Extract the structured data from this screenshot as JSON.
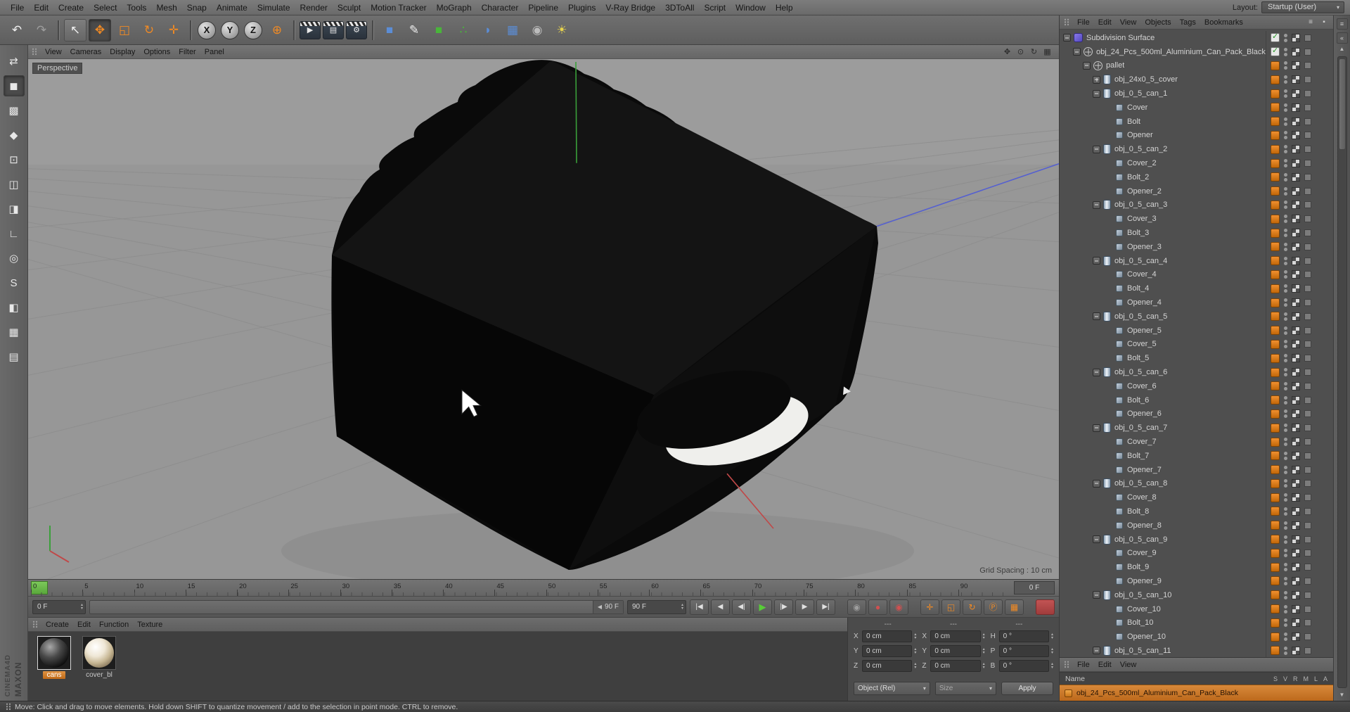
{
  "colors": {
    "accent_orange": "#F08A24",
    "axis_x_red": "#C04848",
    "axis_y_green": "#3AA03A",
    "axis_z_blue": "#5560D0",
    "current_frame_green": "#6FC04A",
    "material_tag_orange": "#D9801E",
    "selected_row_orange": "#C8772B"
  },
  "menu_bar": {
    "items": [
      "File",
      "Edit",
      "Create",
      "Select",
      "Tools",
      "Mesh",
      "Snap",
      "Animate",
      "Simulate",
      "Render",
      "Sculpt",
      "Motion Tracker",
      "MoGraph",
      "Character",
      "Pipeline",
      "Plugins",
      "V-Ray Bridge",
      "3DToAll",
      "Script",
      "Window",
      "Help"
    ],
    "layout_label": "Layout:",
    "layout_value": "Startup (User)"
  },
  "toolbar": {
    "buttons": [
      {
        "name": "undo-button",
        "g": "↶",
        "c": "c-white"
      },
      {
        "name": "redo-button",
        "g": "↷",
        "c": "c-dim"
      },
      {
        "name": "toolbar-separator",
        "g": "",
        "c": "sep",
        "ia": "false"
      },
      {
        "name": "live-selection-button",
        "g": "↖",
        "c": "c-white",
        "s": "raised"
      },
      {
        "name": "move-tool-button",
        "g": "✥",
        "c": "c-orange",
        "s": "pressed"
      },
      {
        "name": "scale-tool-button",
        "g": "◱",
        "c": "c-orange"
      },
      {
        "name": "rotate-tool-button",
        "g": "↻",
        "c": "c-orange"
      },
      {
        "name": "last-tool-button",
        "g": "✛",
        "c": "c-orange"
      },
      {
        "name": "toolbar-separator",
        "g": "",
        "c": "sep",
        "ia": "false"
      },
      {
        "name": "x-axis-lock-button",
        "g": "X",
        "c": "axis"
      },
      {
        "name": "y-axis-lock-button",
        "g": "Y",
        "c": "axis"
      },
      {
        "name": "z-axis-lock-button",
        "g": "Z",
        "c": "axis"
      },
      {
        "name": "coordinate-system-button",
        "g": "⊕",
        "c": "c-orange"
      },
      {
        "name": "toolbar-separator",
        "g": "",
        "c": "sep",
        "ia": "false"
      },
      {
        "name": "render-view-button",
        "g": "▶",
        "c": "clapper"
      },
      {
        "name": "render-picture-viewer-button",
        "g": "▤",
        "c": "clapper"
      },
      {
        "name": "render-settings-button",
        "g": "⚙",
        "c": "clapper"
      },
      {
        "name": "toolbar-separator",
        "g": "",
        "c": "sep",
        "ia": "false"
      },
      {
        "name": "primitive-cube-button",
        "g": "■",
        "c": "c-blue"
      },
      {
        "name": "spline-pen-button",
        "g": "✎",
        "c": "c-white"
      },
      {
        "name": "subdivision-surface-button",
        "g": "■",
        "c": "c-green"
      },
      {
        "name": "generators-button",
        "g": "∴",
        "c": "c-green"
      },
      {
        "name": "deformers-button",
        "g": "◗",
        "c": "c-blue"
      },
      {
        "name": "environment-button",
        "g": "▦",
        "c": "c-blue"
      },
      {
        "name": "camera-button",
        "g": "◉",
        "c": "c-dim2"
      },
      {
        "name": "light-button",
        "g": "☀",
        "c": "c-yellow"
      }
    ]
  },
  "left_palette": {
    "buttons": [
      {
        "name": "make-editable-button",
        "g": "⇄",
        "c": "c-white"
      },
      {
        "name": "model-mode-button",
        "g": "◼",
        "c": "c-white",
        "s": "pressed"
      },
      {
        "name": "texture-mode-button",
        "g": "▩",
        "c": "c-white"
      },
      {
        "name": "workplane-mode-button",
        "g": "◆",
        "c": "c-orange"
      },
      {
        "name": "points-mode-button",
        "g": "⊡",
        "c": "c-white"
      },
      {
        "name": "edges-mode-button",
        "g": "◫",
        "c": "c-white"
      },
      {
        "name": "polygons-mode-button",
        "g": "◨",
        "c": "c-white"
      },
      {
        "name": "axis-mode-button",
        "g": "∟",
        "c": "c-white"
      },
      {
        "name": "viewport-solo-button",
        "g": "◎",
        "c": "c-white"
      },
      {
        "name": "snap-button",
        "g": "S",
        "c": "c-white"
      },
      {
        "name": "paint-tool-button",
        "g": "◧",
        "c": "c-orange"
      },
      {
        "name": "lock-workplane-button",
        "g": "▦",
        "c": "c-white"
      },
      {
        "name": "quantize-button",
        "g": "▤",
        "c": "c-dim"
      }
    ]
  },
  "viewport": {
    "menu": [
      "View",
      "Cameras",
      "Display",
      "Options",
      "Filter",
      "Panel"
    ],
    "cam_icons": [
      {
        "name": "pan-view-icon",
        "g": "✥"
      },
      {
        "name": "zoom-view-icon",
        "g": "⊙"
      },
      {
        "name": "rotate-view-icon",
        "g": "↻"
      },
      {
        "name": "toggle-views-icon",
        "g": "▦"
      }
    ],
    "view_label": "Perspective",
    "grid_spacing": "Grid Spacing : 10 cm"
  },
  "timeline": {
    "ticks": [
      "0",
      "5",
      "10",
      "15",
      "20",
      "25",
      "30",
      "35",
      "40",
      "45",
      "50",
      "55",
      "60",
      "65",
      "70",
      "75",
      "80",
      "85",
      "90"
    ],
    "frame_box": "0 F",
    "current_frame": "0 F",
    "range_end_label": "90 F",
    "end_frame": "90 F",
    "buttons": [
      {
        "name": "goto-start-button",
        "g": "|◀"
      },
      {
        "name": "goto-prev-key-button",
        "g": "◀"
      },
      {
        "name": "goto-prev-frame-button",
        "g": "◀|"
      },
      {
        "name": "play-button",
        "g": "▶",
        "c": "play"
      },
      {
        "name": "goto-next-frame-button",
        "g": "|▶"
      },
      {
        "name": "goto-next-key-button",
        "g": "▶"
      },
      {
        "name": "goto-end-button",
        "g": "▶|"
      },
      {
        "name": "record-objects-button",
        "g": "◉",
        "c": "c-dim",
        "s": "gap-l"
      },
      {
        "name": "autokeying-button",
        "g": "●",
        "c": "c-red"
      },
      {
        "name": "record-options-button",
        "g": "◉",
        "c": "c-red"
      },
      {
        "name": "record-position-button",
        "g": "✛",
        "c": "c-orange",
        "s": "gap-l"
      },
      {
        "name": "record-scale-button",
        "g": "◱",
        "c": "c-orange"
      },
      {
        "name": "record-rotation-button",
        "g": "↻",
        "c": "c-orange"
      },
      {
        "name": "record-parameter-button",
        "g": "Ⓟ",
        "c": "c-orange"
      },
      {
        "name": "record-pla-button",
        "g": "▦",
        "c": "c-orange"
      },
      {
        "name": "autokey-master-button",
        "g": "",
        "c": "autokey",
        "s": "gap-l"
      }
    ]
  },
  "materials": {
    "menu": [
      "Create",
      "Edit",
      "Function",
      "Texture"
    ],
    "items": [
      {
        "name": "cans",
        "cls": "mat-cans",
        "sel": "selected"
      },
      {
        "name": "cover_bl",
        "cls": "mat-cover"
      }
    ]
  },
  "coordinates": {
    "headers": [
      "---",
      "---",
      "---"
    ],
    "labels": {
      "pos": [
        "X",
        "Y",
        "Z"
      ],
      "size": [
        "X",
        "Y",
        "Z"
      ],
      "rot": [
        "H",
        "P",
        "B"
      ]
    },
    "position": {
      "x": "0 cm",
      "y": "0 cm",
      "z": "0 cm"
    },
    "size": {
      "x": "0 cm",
      "y": "0 cm",
      "z": "0 cm"
    },
    "rotation": {
      "h": "0 °",
      "p": "0 °",
      "b": "0 °"
    },
    "transform_mode": "Object (Rel)",
    "size_mode": "Size",
    "apply": "Apply"
  },
  "object_manager": {
    "menu": [
      "File",
      "Edit",
      "View",
      "Objects",
      "Tags",
      "Bookmarks"
    ],
    "tree": [
      {
        "l": "Subdivision Surface",
        "lv": 0,
        "i": "sds",
        "e": "minus",
        "t": "check"
      },
      {
        "l": "obj_24_Pcs_500ml_Aluminium_Can_Pack_Black",
        "lv": 1,
        "i": "null",
        "e": "minus",
        "t": "check"
      },
      {
        "l": "pallet",
        "lv": 2,
        "i": "null",
        "e": "minus",
        "t": "mat"
      },
      {
        "l": "obj_24x0_5_cover",
        "lv": 3,
        "i": "can",
        "e": "plus",
        "t": "mat"
      },
      {
        "l": "obj_0_5_can_1",
        "lv": 3,
        "i": "can",
        "e": "minus",
        "t": "mat"
      },
      {
        "l": "Cover",
        "lv": 4,
        "i": "part",
        "e": "none",
        "t": "mat"
      },
      {
        "l": "Bolt",
        "lv": 4,
        "i": "part",
        "e": "none",
        "t": "mat"
      },
      {
        "l": "Opener",
        "lv": 4,
        "i": "part",
        "e": "none",
        "t": "mat"
      },
      {
        "l": "obj_0_5_can_2",
        "lv": 3,
        "i": "can",
        "e": "minus",
        "t": "mat"
      },
      {
        "l": "Cover_2",
        "lv": 4,
        "i": "part",
        "e": "none",
        "t": "mat"
      },
      {
        "l": "Bolt_2",
        "lv": 4,
        "i": "part",
        "e": "none",
        "t": "mat"
      },
      {
        "l": "Opener_2",
        "lv": 4,
        "i": "part",
        "e": "none",
        "t": "mat"
      },
      {
        "l": "obj_0_5_can_3",
        "lv": 3,
        "i": "can",
        "e": "minus",
        "t": "mat"
      },
      {
        "l": "Cover_3",
        "lv": 4,
        "i": "part",
        "e": "none",
        "t": "mat"
      },
      {
        "l": "Bolt_3",
        "lv": 4,
        "i": "part",
        "e": "none",
        "t": "mat"
      },
      {
        "l": "Opener_3",
        "lv": 4,
        "i": "part",
        "e": "none",
        "t": "mat"
      },
      {
        "l": "obj_0_5_can_4",
        "lv": 3,
        "i": "can",
        "e": "minus",
        "t": "mat"
      },
      {
        "l": "Cover_4",
        "lv": 4,
        "i": "part",
        "e": "none",
        "t": "mat"
      },
      {
        "l": "Bolt_4",
        "lv": 4,
        "i": "part",
        "e": "none",
        "t": "mat"
      },
      {
        "l": "Opener_4",
        "lv": 4,
        "i": "part",
        "e": "none",
        "t": "mat"
      },
      {
        "l": "obj_0_5_can_5",
        "lv": 3,
        "i": "can",
        "e": "minus",
        "t": "mat"
      },
      {
        "l": "Opener_5",
        "lv": 4,
        "i": "part",
        "e": "none",
        "t": "mat"
      },
      {
        "l": "Cover_5",
        "lv": 4,
        "i": "part",
        "e": "none",
        "t": "mat"
      },
      {
        "l": "Bolt_5",
        "lv": 4,
        "i": "part",
        "e": "none",
        "t": "mat"
      },
      {
        "l": "obj_0_5_can_6",
        "lv": 3,
        "i": "can",
        "e": "minus",
        "t": "mat"
      },
      {
        "l": "Cover_6",
        "lv": 4,
        "i": "part",
        "e": "none",
        "t": "mat"
      },
      {
        "l": "Bolt_6",
        "lv": 4,
        "i": "part",
        "e": "none",
        "t": "mat"
      },
      {
        "l": "Opener_6",
        "lv": 4,
        "i": "part",
        "e": "none",
        "t": "mat"
      },
      {
        "l": "obj_0_5_can_7",
        "lv": 3,
        "i": "can",
        "e": "minus",
        "t": "mat"
      },
      {
        "l": "Cover_7",
        "lv": 4,
        "i": "part",
        "e": "none",
        "t": "mat"
      },
      {
        "l": "Bolt_7",
        "lv": 4,
        "i": "part",
        "e": "none",
        "t": "mat"
      },
      {
        "l": "Opener_7",
        "lv": 4,
        "i": "part",
        "e": "none",
        "t": "mat"
      },
      {
        "l": "obj_0_5_can_8",
        "lv": 3,
        "i": "can",
        "e": "minus",
        "t": "mat"
      },
      {
        "l": "Cover_8",
        "lv": 4,
        "i": "part",
        "e": "none",
        "t": "mat"
      },
      {
        "l": "Bolt_8",
        "lv": 4,
        "i": "part",
        "e": "none",
        "t": "mat"
      },
      {
        "l": "Opener_8",
        "lv": 4,
        "i": "part",
        "e": "none",
        "t": "mat"
      },
      {
        "l": "obj_0_5_can_9",
        "lv": 3,
        "i": "can",
        "e": "minus",
        "t": "mat"
      },
      {
        "l": "Cover_9",
        "lv": 4,
        "i": "part",
        "e": "none",
        "t": "mat"
      },
      {
        "l": "Bolt_9",
        "lv": 4,
        "i": "part",
        "e": "none",
        "t": "mat"
      },
      {
        "l": "Opener_9",
        "lv": 4,
        "i": "part",
        "e": "none",
        "t": "mat"
      },
      {
        "l": "obj_0_5_can_10",
        "lv": 3,
        "i": "can",
        "e": "minus",
        "t": "mat"
      },
      {
        "l": "Cover_10",
        "lv": 4,
        "i": "part",
        "e": "none",
        "t": "mat"
      },
      {
        "l": "Bolt_10",
        "lv": 4,
        "i": "part",
        "e": "none",
        "t": "mat"
      },
      {
        "l": "Opener_10",
        "lv": 4,
        "i": "part",
        "e": "none",
        "t": "mat"
      },
      {
        "l": "obj_0_5_can_11",
        "lv": 3,
        "i": "can",
        "e": "minus",
        "t": "mat"
      }
    ]
  },
  "layer_panel": {
    "menu": [
      "File",
      "Edit",
      "View"
    ],
    "name_header": "Name",
    "columns": [
      "S",
      "V",
      "R",
      "M",
      "L",
      "A"
    ],
    "selected_row": "obj_24_Pcs_500ml_Aluminium_Can_Pack_Black"
  },
  "status_bar": {
    "text": "Move: Click and drag to move elements. Hold down SHIFT to quantize movement / add to the selection in point mode. CTRL to remove."
  },
  "branding": {
    "line1": "MAXON",
    "line2": "CINEMA4D"
  }
}
